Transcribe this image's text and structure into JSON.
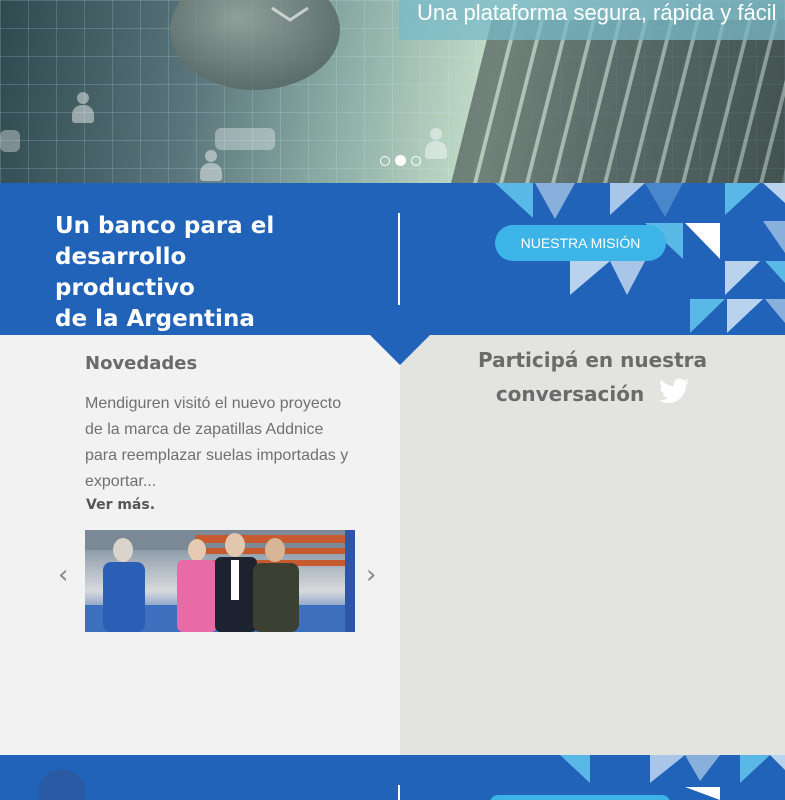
{
  "hero": {
    "tagline": "Una plataforma segura, rápida y fácil",
    "slides": [
      {
        "label": "slide-1",
        "active": false
      },
      {
        "label": "slide-2",
        "active": true
      },
      {
        "label": "slide-3",
        "active": false
      }
    ]
  },
  "mission": {
    "title": "Un banco para el desarrollo\nproductivo\nde la Argentina",
    "button_label": "NUESTRA MISIÓN"
  },
  "news": {
    "heading": "Novedades",
    "excerpt": "Mendiguren visitó el nuevo proyecto de la marca de zapatillas Addnice para reemplazar suelas importadas y exportar...",
    "more_label": "Ver más.",
    "prev_icon": "chevron-left-icon",
    "next_icon": "chevron-right-icon"
  },
  "twitter": {
    "title_line1": "Participá en nuestra",
    "title_line2": "conversación",
    "icon": "twitter-bird-icon"
  },
  "colors": {
    "brand_blue": "#2163b8",
    "accent_cyan": "#3db4e8",
    "panel_left": "#f2f2f2",
    "panel_right": "#e3e4e0"
  }
}
